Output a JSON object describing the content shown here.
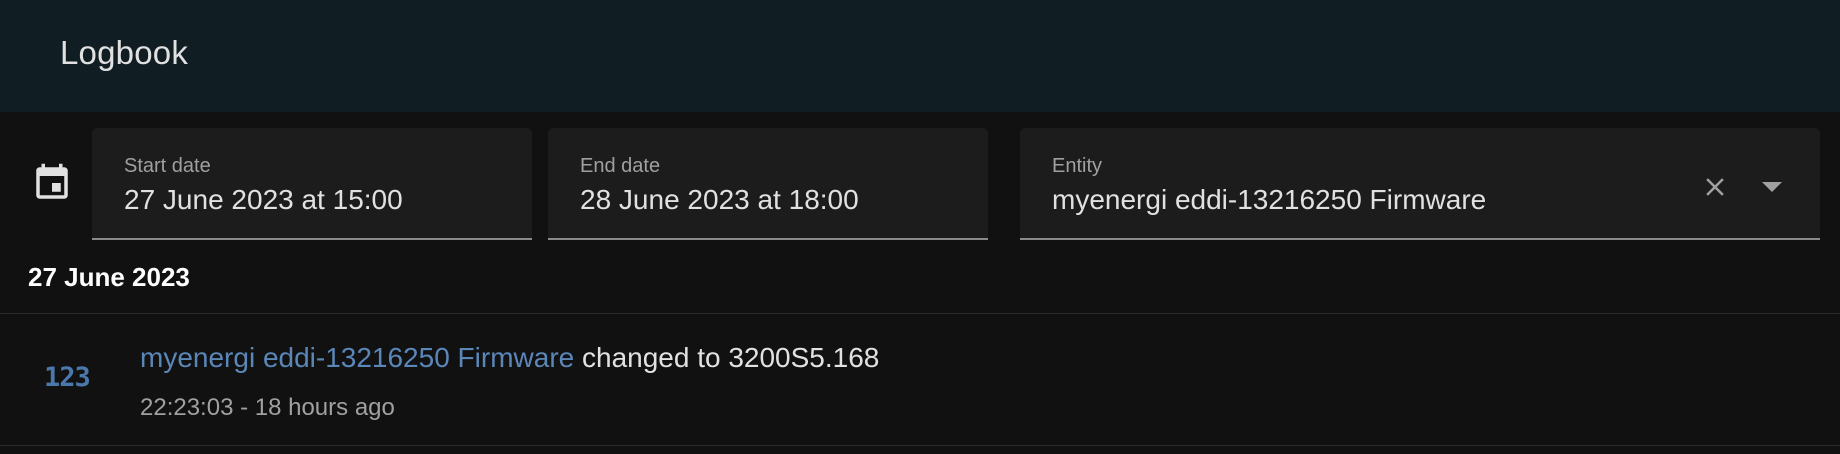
{
  "header": {
    "title": "Logbook"
  },
  "filters": {
    "start": {
      "label": "Start date",
      "value": "27 June 2023 at 15:00"
    },
    "end": {
      "label": "End date",
      "value": "28 June 2023 at 18:00"
    },
    "entity": {
      "label": "Entity",
      "value": "myenergi eddi-13216250 Firmware"
    }
  },
  "icons": {
    "calendar": "calendar-icon",
    "clear": "close-icon",
    "dropdown": "menu-down-icon",
    "entry": "numeric-icon"
  },
  "log": {
    "date_heading": "27 June 2023",
    "entries": [
      {
        "icon_text": "123",
        "entity_name": "myenergi eddi-13216250 Firmware",
        "message": "changed to 3200S5.168",
        "time": "22:23:03 - 18 hours ago"
      }
    ]
  },
  "colors": {
    "header_bg": "#101e24",
    "page_bg": "#111111",
    "field_bg": "#1c1c1c",
    "link": "#5b86b8"
  }
}
